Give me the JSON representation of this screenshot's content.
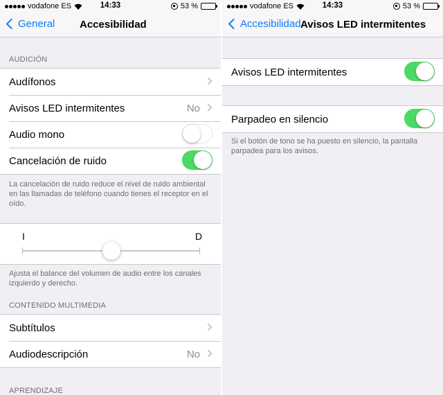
{
  "status": {
    "carrier": "vodafone ES",
    "time": "14:33",
    "battery": "53 %",
    "battery_level": 0.53
  },
  "left": {
    "back_label": "General",
    "title": "Accesibilidad",
    "section_audio": "AUDICIÓN",
    "rows_audio": [
      {
        "label": "Audífonos"
      },
      {
        "label": "Avisos LED intermitentes",
        "value": "No"
      },
      {
        "label": "Audio mono",
        "switch": "off"
      },
      {
        "label": "Cancelación de ruido",
        "switch": "on"
      }
    ],
    "noise_footer": "La cancelación de ruido reduce el nivel de ruido ambiental en las llamadas de teléfono cuando tienes el receptor en el oído.",
    "balance": {
      "left_label": "I",
      "right_label": "D",
      "level": 0.5
    },
    "balance_footer": "Ajusta el balance del volumen de audio entre los canales izquierdo y derecho.",
    "section_media": "CONTENIDO MULTIMEDIA",
    "rows_media": [
      {
        "label": "Subtítulos"
      },
      {
        "label": "Audiodescripción",
        "value": "No"
      }
    ],
    "section_learning": "APRENDIZAJE"
  },
  "right": {
    "back_label": "Accesibilidad",
    "title": "Avisos LED intermitentes",
    "row_led": {
      "label": "Avisos LED intermitentes",
      "switch": "on"
    },
    "row_silent": {
      "label": "Parpadeo en silencio",
      "switch": "on"
    },
    "silent_footer": "Si el botón de tono se ha puesto en silencio, la pantalla parpadea para los avisos."
  }
}
